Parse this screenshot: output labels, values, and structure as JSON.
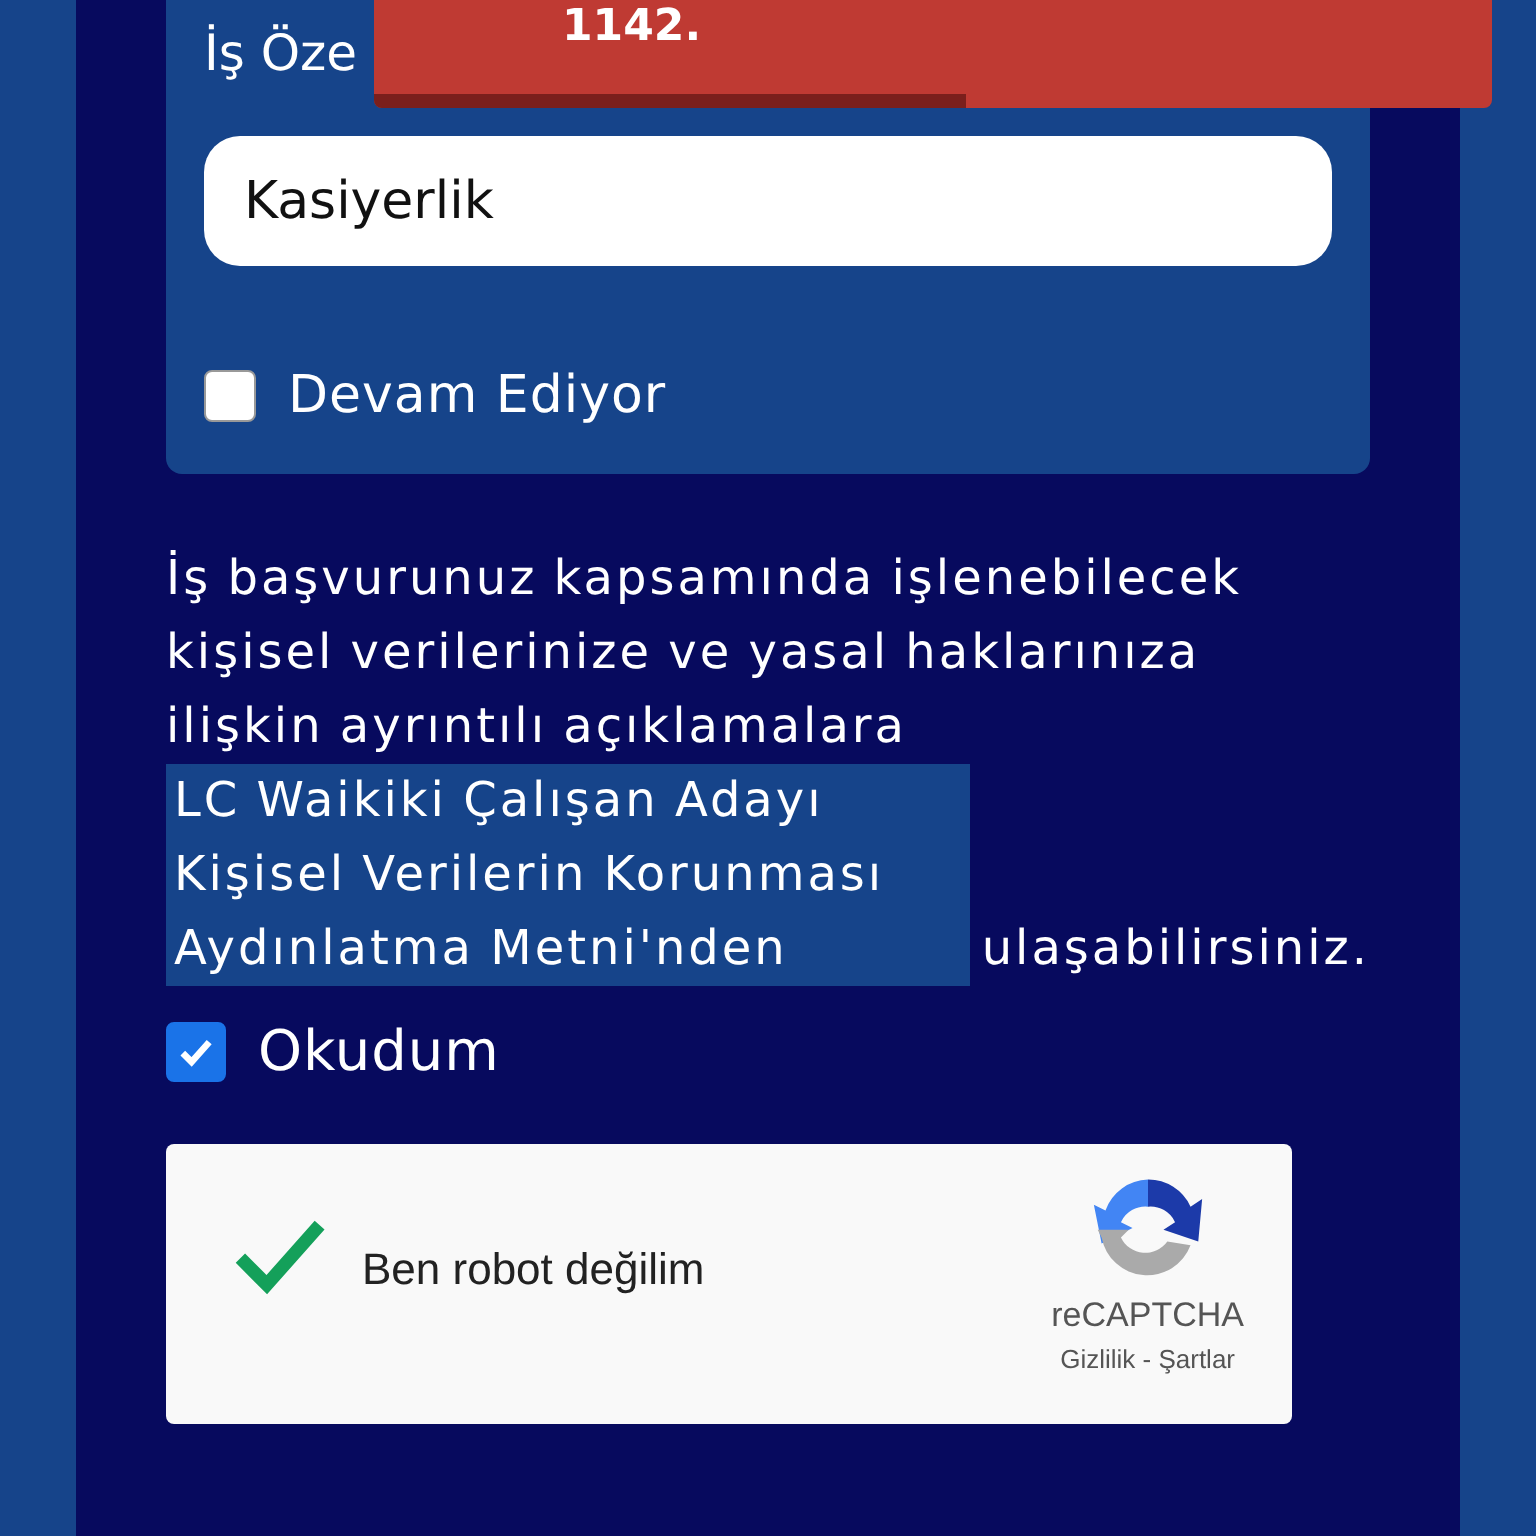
{
  "card": {
    "label": "İş Öze",
    "input_value": "Kasiyerlik",
    "ongoing": {
      "label": "Devam Ediyor",
      "checked": false
    }
  },
  "consent": {
    "text_before": "İş başvurunuz kapsamında işlenebilecek kişisel verilerinize ve yasal haklarınıza ilişkin ayrıntılı açıklamalara",
    "link": "LC Waikiki Çalışan Adayı Kişisel Verilerin Korunması Aydınlatma Metni'nden",
    "text_after": "ulaşabilirsiniz."
  },
  "read": {
    "label": "Okudum",
    "checked": true
  },
  "captcha": {
    "label": "Ben robot değilim",
    "verified": true,
    "brand": "reCAPTCHA",
    "links": "Gizlilik - Şartlar"
  },
  "toast": {
    "text": "1142.",
    "level": 0.53
  }
}
